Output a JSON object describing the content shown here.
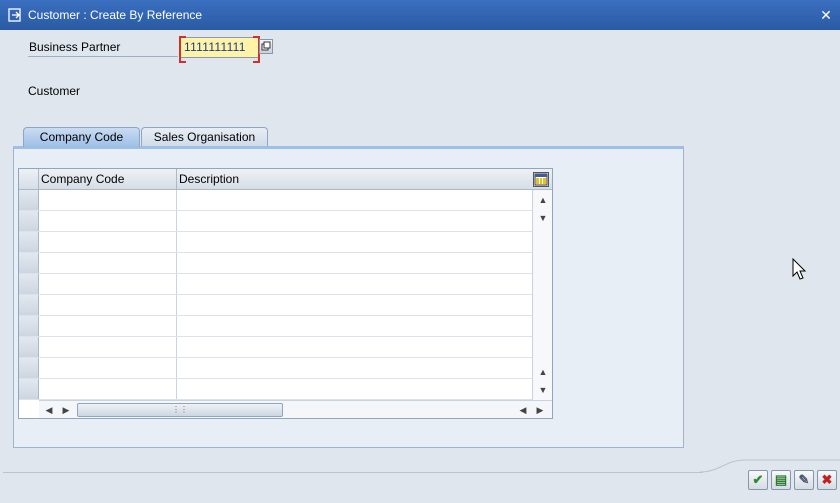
{
  "window": {
    "title": "Customer : Create By Reference",
    "close_glyph": "✕"
  },
  "form": {
    "business_partner_label": "Business Partner",
    "business_partner_value": "1111111111",
    "customer_label": "Customer"
  },
  "tabs": [
    {
      "label": "Company Code",
      "active": true
    },
    {
      "label": "Sales Organisation",
      "active": false
    }
  ],
  "table": {
    "columns": [
      "Company Code",
      "Description"
    ],
    "row_count": 10
  },
  "icons": {
    "title": "create-icon",
    "value_help": "value-help-icon",
    "layout": "column-layout-icon",
    "scroll_up": "▲",
    "scroll_down": "▼",
    "scroll_left": "◀",
    "scroll_right": "▶",
    "grip": "⋮⋮"
  },
  "actions": [
    {
      "name": "continue-button",
      "glyph": "✔",
      "color": "#2e8b2e"
    },
    {
      "name": "details-button",
      "glyph": "▤",
      "color": "#2e7d2e"
    },
    {
      "name": "edit-button",
      "glyph": "✎",
      "color": "#4a5a70"
    },
    {
      "name": "cancel-button",
      "glyph": "✖",
      "color": "#c02020"
    }
  ],
  "colors": {
    "title_bar": "#2a5aa3",
    "required_field": "#fff3a8",
    "active_tab": "#9ebfe6"
  }
}
